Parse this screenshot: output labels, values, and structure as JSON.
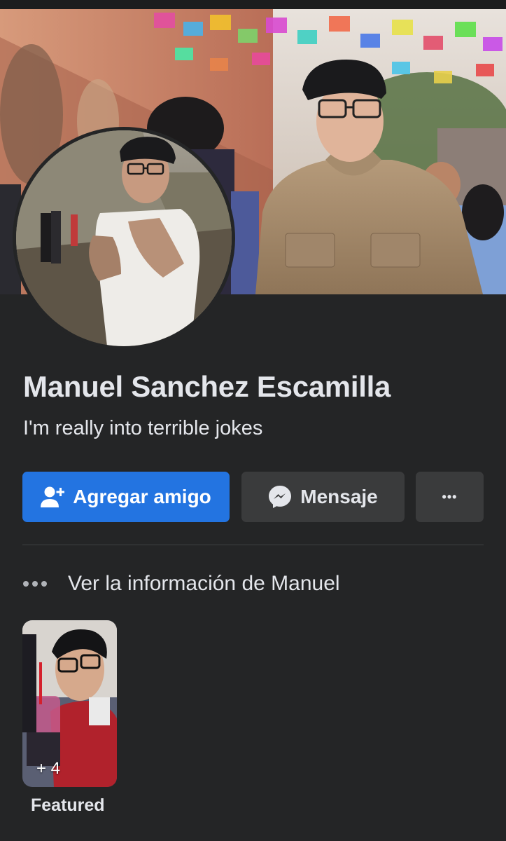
{
  "profile": {
    "name": "Manuel Sanchez Escamilla",
    "bio": "I'm really into terrible jokes"
  },
  "actions": {
    "add_friend_label": "Agregar amigo",
    "message_label": "Mensaje",
    "more_label": "•••"
  },
  "about": {
    "link_label": "Ver la información de Manuel"
  },
  "featured": {
    "count_label": "+ 4",
    "label": "Featured"
  },
  "colors": {
    "background": "#242526",
    "primary_button": "#2374e1",
    "secondary_button": "#3a3b3c",
    "text": "#e4e6eb"
  },
  "icons": {
    "add_friend": "person-add-icon",
    "message": "messenger-icon",
    "more": "more-dots-icon",
    "about": "more-dots-icon"
  }
}
